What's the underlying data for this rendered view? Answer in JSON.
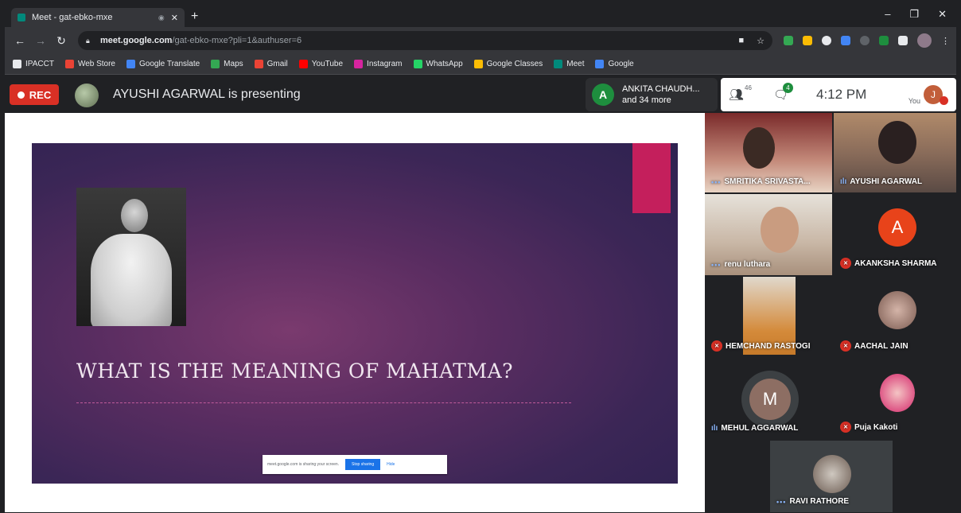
{
  "browser": {
    "tab_title": "Meet - gat-ebko-mxe",
    "tab_close": "✕",
    "new_tab": "+",
    "url_host": "meet.google.com",
    "url_path": "/gat-ebko-mxe?pli=1&authuser=6",
    "window_controls": [
      "–",
      "❐",
      "✕"
    ]
  },
  "bookmarks": [
    {
      "label": "IPACCT",
      "color": "#e8eaed"
    },
    {
      "label": "Web Store",
      "color": "#ea4335"
    },
    {
      "label": "Google Translate",
      "color": "#4285f4"
    },
    {
      "label": "Maps",
      "color": "#34a853"
    },
    {
      "label": "Gmail",
      "color": "#ea4335"
    },
    {
      "label": "YouTube",
      "color": "#ff0000"
    },
    {
      "label": "Instagram",
      "color": "#d6249f"
    },
    {
      "label": "WhatsApp",
      "color": "#25d366"
    },
    {
      "label": "Google Classes",
      "color": "#fbbc04"
    },
    {
      "label": "Meet",
      "color": "#00897b"
    },
    {
      "label": "Google",
      "color": "#4285f4"
    }
  ],
  "meet": {
    "rec_label": "REC",
    "presenter_text": "AYUSHI AGARWAL is presenting",
    "notification": {
      "initial": "A",
      "line1": "ANKITA CHAUDH...",
      "line2": "and 34 more"
    },
    "people_count": "46",
    "chat_badge": "4",
    "time": "4:12 PM",
    "you_label": "You",
    "you_initial": "J"
  },
  "slide": {
    "title": "WHAT IS THE MEANING OF MAHATMA?",
    "share_text": "meet.google.com is sharing your screen.",
    "stop_sharing": "Stop sharing",
    "hide": "Hide"
  },
  "participants": [
    {
      "name": "SMRITIKA SRIVASTA...",
      "state": "dots"
    },
    {
      "name": "AYUSHI AGARWAL",
      "state": "speaking"
    },
    {
      "name": "renu luthara",
      "state": "dots"
    },
    {
      "name": "AKANKSHA SHARMA",
      "state": "muted",
      "initial": "A"
    },
    {
      "name": "HEMCHAND RASTOGI",
      "state": "muted"
    },
    {
      "name": "AACHAL JAIN",
      "state": "muted"
    },
    {
      "name": "MEHUL AGGARWAL",
      "state": "speaking",
      "initial": "M"
    },
    {
      "name": "Puja Kakoti",
      "state": "muted"
    },
    {
      "name": "RAVI RATHORE",
      "state": "dots"
    }
  ],
  "colors": {
    "rec": "#d93025",
    "accent": "#1a73e8",
    "slide_ribbon": "#c41f5c",
    "avatar_a": "#e8431a"
  }
}
